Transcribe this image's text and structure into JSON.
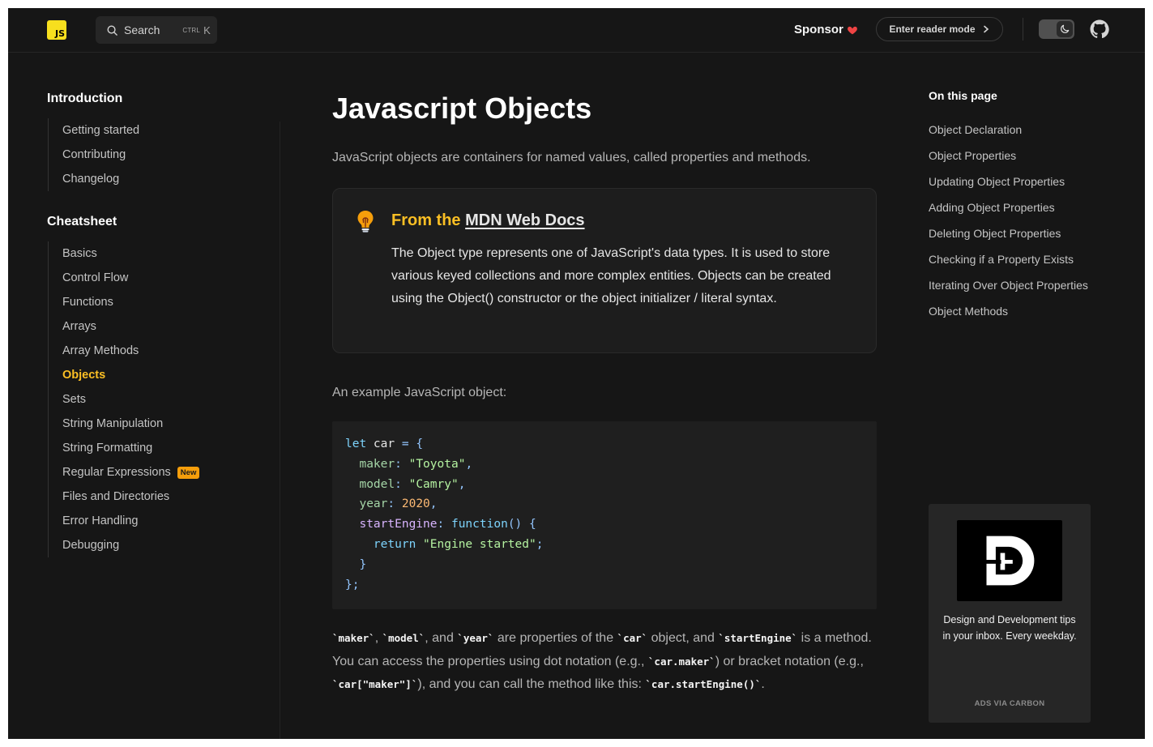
{
  "header": {
    "logo_text": "JS",
    "search_label": "Search",
    "search_shortcut_modifier": "CTRL",
    "search_shortcut_key": "K",
    "sponsor_label": "Sponsor",
    "reader_mode_label": "Enter reader mode",
    "accent_color": "#f7df1e",
    "heart_color": "#ef4444"
  },
  "sidebar": {
    "sections": [
      {
        "title": "Introduction",
        "items": [
          {
            "label": "Getting started"
          },
          {
            "label": "Contributing"
          },
          {
            "label": "Changelog"
          }
        ]
      },
      {
        "title": "Cheatsheet",
        "items": [
          {
            "label": "Basics"
          },
          {
            "label": "Control Flow"
          },
          {
            "label": "Functions"
          },
          {
            "label": "Arrays"
          },
          {
            "label": "Array Methods"
          },
          {
            "label": "Objects",
            "active": true
          },
          {
            "label": "Sets"
          },
          {
            "label": "String Manipulation"
          },
          {
            "label": "String Formatting"
          },
          {
            "label": "Regular Expressions",
            "badge": "New"
          },
          {
            "label": "Files and Directories"
          },
          {
            "label": "Error Handling"
          },
          {
            "label": "Debugging"
          }
        ]
      }
    ],
    "active_color": "#fbbf24"
  },
  "main": {
    "title": "Javascript Objects",
    "lead": "JavaScript objects are containers for named values, called properties and methods.",
    "callout": {
      "heading_prefix": "From the",
      "heading_link": "MDN Web Docs",
      "body": "The Object type represents one of JavaScript's data types. It is used to store various keyed collections and more complex entities. Objects can be created using the Object() constructor or the object initializer / literal syntax."
    },
    "example_label": "An example JavaScript object:",
    "code": {
      "l1_kw": "let",
      "l1_name": " car ",
      "l1_rest": "= {",
      "l2_key": "maker",
      "l2_val": "\"Toyota\"",
      "l3_key": "model",
      "l3_val": "\"Camry\"",
      "l4_key": "year",
      "l4_val": "2020",
      "l5_key": "startEngine",
      "l5_fn": "function",
      "l5_rest": "() {",
      "l6_kw": "return",
      "l6_val": "\"Engine started\"",
      "l7": "}",
      "l8": "};"
    },
    "para": {
      "c1": "`maker`",
      "t1": ", ",
      "c2": "`model`",
      "t2": ", and ",
      "c3": "`year`",
      "t3": " are properties of the ",
      "c4": "`car`",
      "t4": " object, and ",
      "c5": "`startEngine`",
      "t5": " is a method. You can access the properties using dot notation (e.g., ",
      "c6": "`car.maker`",
      "t6": ") or bracket notation (e.g., ",
      "c7": "`car[\"maker\"]`",
      "t7": "), and you can call the method like this: ",
      "c8": "`car.startEngine()`",
      "t8": "."
    }
  },
  "toc": {
    "title": "On this page",
    "items": [
      "Object Declaration",
      "Object Properties",
      "Updating Object Properties",
      "Adding Object Properties",
      "Deleting Object Properties",
      "Checking if a Property Exists",
      "Iterating Over Object Properties",
      "Object Methods"
    ]
  },
  "ad": {
    "text": "Design and Development tips in your inbox. Every weekday.",
    "via": "ADS VIA CARBON"
  }
}
